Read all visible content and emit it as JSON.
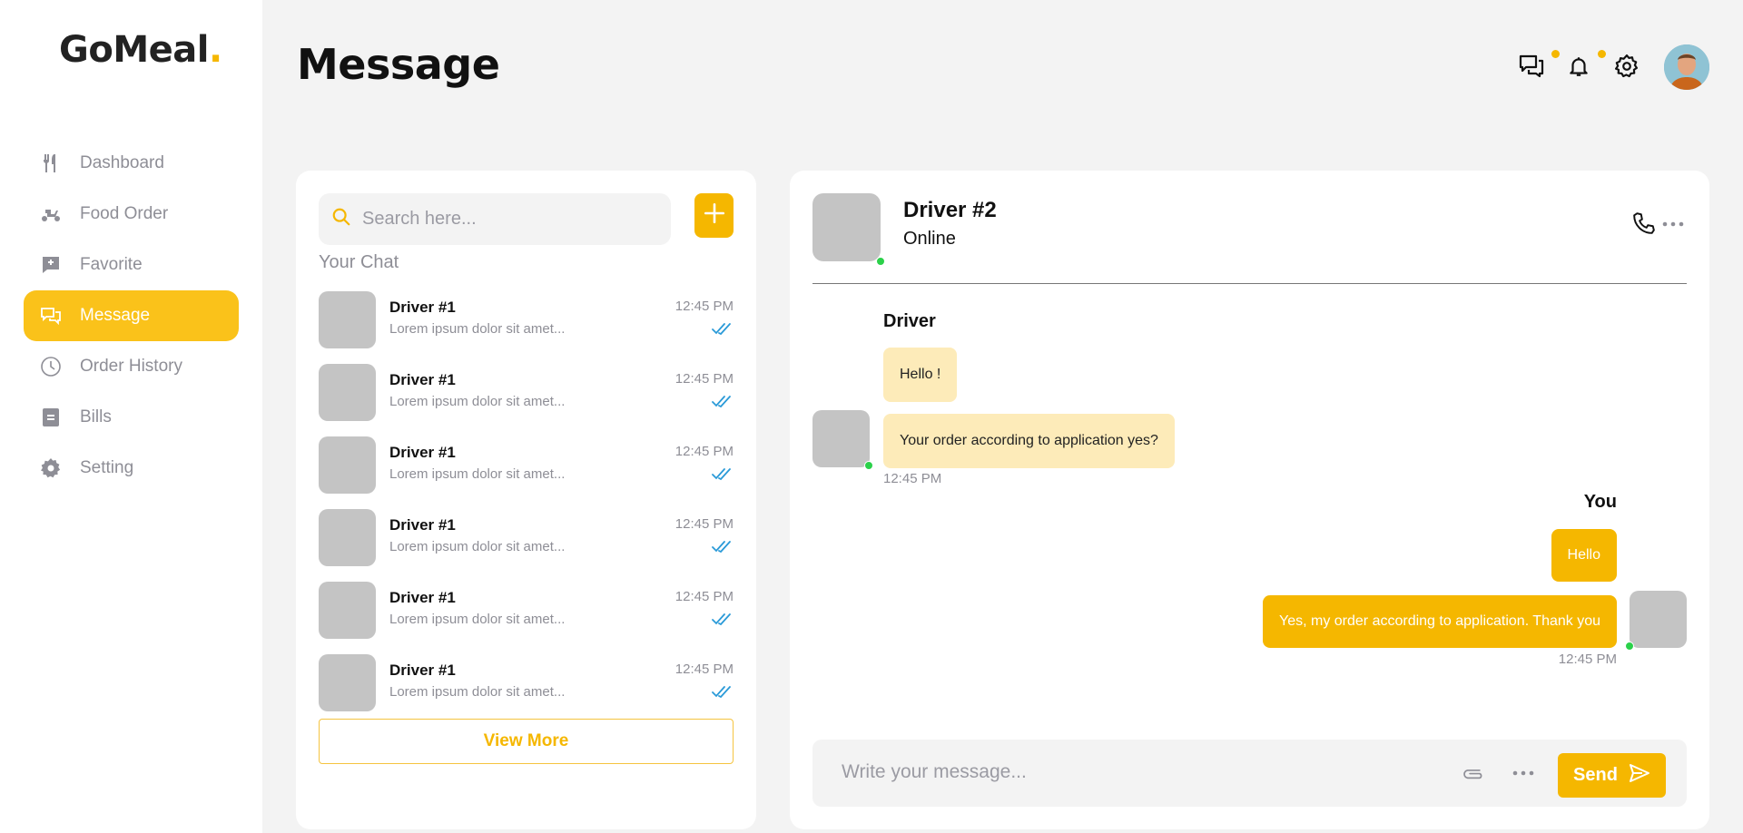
{
  "app": {
    "logo_text": "GoMeal",
    "logo_dot": ".",
    "accent": "#f5b700"
  },
  "sidebar": {
    "items": [
      {
        "label": "Dashboard",
        "icon": "utensils-icon",
        "active": false
      },
      {
        "label": "Food Order",
        "icon": "scooter-icon",
        "active": false
      },
      {
        "label": "Favorite",
        "icon": "favorite-message-icon",
        "active": false
      },
      {
        "label": "Message",
        "icon": "chat-icon",
        "active": true
      },
      {
        "label": "Order History",
        "icon": "clock-icon",
        "active": false
      },
      {
        "label": "Bills",
        "icon": "bill-icon",
        "active": false
      },
      {
        "label": "Setting",
        "icon": "gear-icon",
        "active": false
      }
    ]
  },
  "header": {
    "title": "Message"
  },
  "chat_list": {
    "search_placeholder": "Search here...",
    "section_title": "Your Chat",
    "items": [
      {
        "name": "Driver #1",
        "preview": "Lorem ipsum dolor sit amet...",
        "time": "12:45 PM"
      },
      {
        "name": "Driver #1",
        "preview": "Lorem ipsum dolor sit amet...",
        "time": "12:45 PM"
      },
      {
        "name": "Driver #1",
        "preview": "Lorem ipsum dolor sit amet...",
        "time": "12:45 PM"
      },
      {
        "name": "Driver #1",
        "preview": "Lorem ipsum dolor sit amet...",
        "time": "12:45 PM"
      },
      {
        "name": "Driver #1",
        "preview": "Lorem ipsum dolor sit amet...",
        "time": "12:45 PM"
      },
      {
        "name": "Driver #1",
        "preview": "Lorem ipsum dolor sit amet...",
        "time": "12:45 PM"
      }
    ],
    "view_more_label": "View More"
  },
  "conversation": {
    "contact_name": "Driver #2",
    "contact_status": "Online",
    "incoming_sender": "Driver",
    "incoming": [
      {
        "text": "Hello !"
      },
      {
        "text": "Your order according to application yes?"
      }
    ],
    "incoming_time": "12:45 PM",
    "outgoing_sender": "You",
    "outgoing": [
      {
        "text": "Hello"
      },
      {
        "text": "Yes, my order according to application. Thank you"
      }
    ],
    "outgoing_time": "12:45 PM",
    "composer_placeholder": "Write your message...",
    "send_label": "Send"
  }
}
